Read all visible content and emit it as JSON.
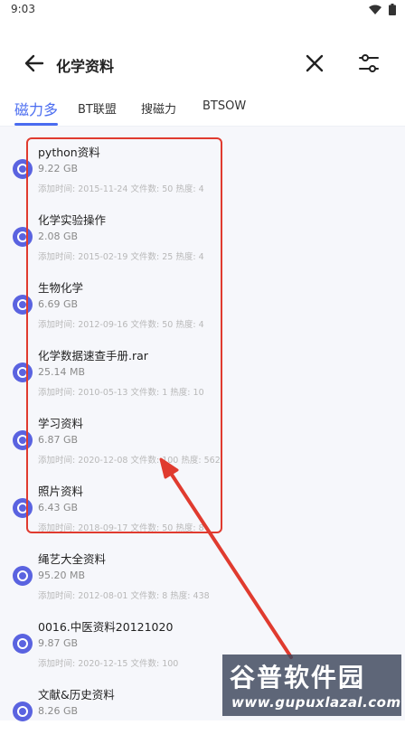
{
  "status_bar": {
    "time": "9:03"
  },
  "app_bar": {
    "title": "化学资料"
  },
  "tabs": [
    {
      "label": "磁力多"
    },
    {
      "label": "BT联盟"
    },
    {
      "label": "搜磁力"
    },
    {
      "label": "BTSOW"
    }
  ],
  "meta_labels": {
    "added": "添加时间:",
    "files": "文件数:",
    "heat": "热度:"
  },
  "items": [
    {
      "title": "python资料",
      "size": "9.22 GB",
      "date": "2015-11-24",
      "files": "50",
      "heat": "4"
    },
    {
      "title": "化学实验操作",
      "size": "2.08 GB",
      "date": "2015-02-19",
      "files": "25",
      "heat": "4"
    },
    {
      "title": "生物化学",
      "size": "6.69 GB",
      "date": "2012-09-16",
      "files": "50",
      "heat": "4"
    },
    {
      "title": "化学数据速查手册.rar",
      "size": "25.14 MB",
      "date": "2010-05-13",
      "files": "1",
      "heat": "10"
    },
    {
      "title": "学习资料",
      "size": "6.87 GB",
      "date": "2020-12-08",
      "files": "100",
      "heat": "562"
    },
    {
      "title": "照片资料",
      "size": "6.43 GB",
      "date": "2018-09-17",
      "files": "50",
      "heat": "8"
    },
    {
      "title": "绳艺大全资料",
      "size": "95.20 MB",
      "date": "2012-08-01",
      "files": "8",
      "heat": "438"
    },
    {
      "title": "0016.中医资料20121020",
      "size": "9.87 GB",
      "date": "2020-12-15",
      "files": "100",
      "heat": ""
    },
    {
      "title": "文献&历史资料",
      "size": "8.26 GB",
      "date": "",
      "files": "",
      "heat": ""
    }
  ],
  "watermark": {
    "title": "谷普软件园",
    "url": "www.gupuxlazal.com"
  },
  "colors": {
    "accent": "#4a6cf0",
    "icon": "#5a63e0",
    "annotation": "#e03b2f"
  }
}
